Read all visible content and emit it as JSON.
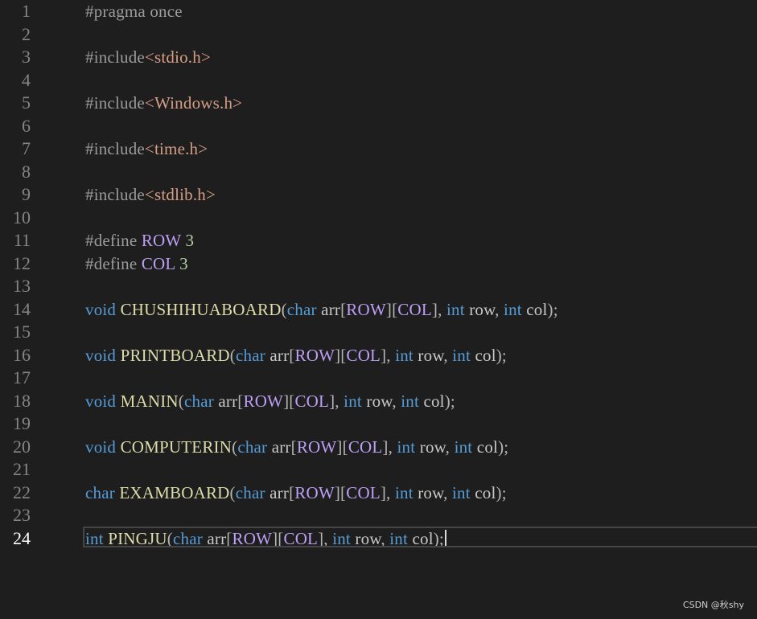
{
  "editor": {
    "lines": [
      {
        "num": "1",
        "tokens": [
          {
            "t": "pp",
            "v": "#pragma once"
          }
        ]
      },
      {
        "num": "2",
        "tokens": []
      },
      {
        "num": "3",
        "tokens": [
          {
            "t": "pp",
            "v": "#include"
          },
          {
            "t": "inc",
            "v": "<stdio.h>"
          }
        ]
      },
      {
        "num": "4",
        "tokens": []
      },
      {
        "num": "5",
        "tokens": [
          {
            "t": "pp",
            "v": "#include"
          },
          {
            "t": "inc",
            "v": "<Windows.h>"
          }
        ]
      },
      {
        "num": "6",
        "tokens": []
      },
      {
        "num": "7",
        "tokens": [
          {
            "t": "pp",
            "v": "#include"
          },
          {
            "t": "inc",
            "v": "<time.h>"
          }
        ]
      },
      {
        "num": "8",
        "tokens": []
      },
      {
        "num": "9",
        "tokens": [
          {
            "t": "pp",
            "v": "#include"
          },
          {
            "t": "inc",
            "v": "<stdlib.h>"
          }
        ]
      },
      {
        "num": "10",
        "tokens": []
      },
      {
        "num": "11",
        "tokens": [
          {
            "t": "pp",
            "v": "#define "
          },
          {
            "t": "mac",
            "v": "ROW"
          },
          {
            "t": "num",
            "v": " 3"
          }
        ]
      },
      {
        "num": "12",
        "tokens": [
          {
            "t": "pp",
            "v": "#define "
          },
          {
            "t": "mac",
            "v": "COL"
          },
          {
            "t": "num",
            "v": " 3"
          }
        ]
      },
      {
        "num": "13",
        "tokens": []
      },
      {
        "num": "14",
        "tokens": [
          {
            "t": "kw",
            "v": "void "
          },
          {
            "t": "fn",
            "v": "CHUSHIHUABOARD"
          },
          {
            "t": "pun",
            "v": "("
          },
          {
            "t": "kw",
            "v": "char "
          },
          {
            "t": "id",
            "v": "arr"
          },
          {
            "t": "pun",
            "v": "["
          },
          {
            "t": "mac",
            "v": "ROW"
          },
          {
            "t": "pun",
            "v": "]["
          },
          {
            "t": "mac",
            "v": "COL"
          },
          {
            "t": "pun",
            "v": "], "
          },
          {
            "t": "kw",
            "v": "int "
          },
          {
            "t": "id",
            "v": "row"
          },
          {
            "t": "pun",
            "v": ", "
          },
          {
            "t": "kw",
            "v": "int "
          },
          {
            "t": "id",
            "v": "col"
          },
          {
            "t": "pun",
            "v": ");"
          }
        ]
      },
      {
        "num": "15",
        "tokens": []
      },
      {
        "num": "16",
        "tokens": [
          {
            "t": "kw",
            "v": "void "
          },
          {
            "t": "fn",
            "v": "PRINTBOARD"
          },
          {
            "t": "pun",
            "v": "("
          },
          {
            "t": "kw",
            "v": "char "
          },
          {
            "t": "id",
            "v": "arr"
          },
          {
            "t": "pun",
            "v": "["
          },
          {
            "t": "mac",
            "v": "ROW"
          },
          {
            "t": "pun",
            "v": "]["
          },
          {
            "t": "mac",
            "v": "COL"
          },
          {
            "t": "pun",
            "v": "], "
          },
          {
            "t": "kw",
            "v": "int "
          },
          {
            "t": "id",
            "v": "row"
          },
          {
            "t": "pun",
            "v": ", "
          },
          {
            "t": "kw",
            "v": "int "
          },
          {
            "t": "id",
            "v": "col"
          },
          {
            "t": "pun",
            "v": ");"
          }
        ]
      },
      {
        "num": "17",
        "tokens": []
      },
      {
        "num": "18",
        "tokens": [
          {
            "t": "kw",
            "v": "void "
          },
          {
            "t": "fn",
            "v": "MANIN"
          },
          {
            "t": "pun",
            "v": "("
          },
          {
            "t": "kw",
            "v": "char "
          },
          {
            "t": "id",
            "v": "arr"
          },
          {
            "t": "pun",
            "v": "["
          },
          {
            "t": "mac",
            "v": "ROW"
          },
          {
            "t": "pun",
            "v": "]["
          },
          {
            "t": "mac",
            "v": "COL"
          },
          {
            "t": "pun",
            "v": "], "
          },
          {
            "t": "kw",
            "v": "int "
          },
          {
            "t": "id",
            "v": "row"
          },
          {
            "t": "pun",
            "v": ", "
          },
          {
            "t": "kw",
            "v": "int "
          },
          {
            "t": "id",
            "v": "col"
          },
          {
            "t": "pun",
            "v": ");"
          }
        ]
      },
      {
        "num": "19",
        "tokens": []
      },
      {
        "num": "20",
        "tokens": [
          {
            "t": "kw",
            "v": "void "
          },
          {
            "t": "fn",
            "v": "COMPUTERIN"
          },
          {
            "t": "pun",
            "v": "("
          },
          {
            "t": "kw",
            "v": "char "
          },
          {
            "t": "id",
            "v": "arr"
          },
          {
            "t": "pun",
            "v": "["
          },
          {
            "t": "mac",
            "v": "ROW"
          },
          {
            "t": "pun",
            "v": "]["
          },
          {
            "t": "mac",
            "v": "COL"
          },
          {
            "t": "pun",
            "v": "], "
          },
          {
            "t": "kw",
            "v": "int "
          },
          {
            "t": "id",
            "v": "row"
          },
          {
            "t": "pun",
            "v": ", "
          },
          {
            "t": "kw",
            "v": "int "
          },
          {
            "t": "id",
            "v": "col"
          },
          {
            "t": "pun",
            "v": ");"
          }
        ]
      },
      {
        "num": "21",
        "tokens": []
      },
      {
        "num": "22",
        "tokens": [
          {
            "t": "kw",
            "v": "char "
          },
          {
            "t": "fn",
            "v": "EXAMBOARD"
          },
          {
            "t": "pun",
            "v": "("
          },
          {
            "t": "kw",
            "v": "char "
          },
          {
            "t": "id",
            "v": "arr"
          },
          {
            "t": "pun",
            "v": "["
          },
          {
            "t": "mac",
            "v": "ROW"
          },
          {
            "t": "pun",
            "v": "]["
          },
          {
            "t": "mac",
            "v": "COL"
          },
          {
            "t": "pun",
            "v": "], "
          },
          {
            "t": "kw",
            "v": "int "
          },
          {
            "t": "id",
            "v": "row"
          },
          {
            "t": "pun",
            "v": ", "
          },
          {
            "t": "kw",
            "v": "int "
          },
          {
            "t": "id",
            "v": "col"
          },
          {
            "t": "pun",
            "v": ");"
          }
        ]
      },
      {
        "num": "23",
        "tokens": []
      },
      {
        "num": "24",
        "current": true,
        "tokens": [
          {
            "t": "kw",
            "v": "int "
          },
          {
            "t": "fn",
            "v": "PINGJU"
          },
          {
            "t": "pun",
            "v": "("
          },
          {
            "t": "kw",
            "v": "char "
          },
          {
            "t": "id",
            "v": "arr"
          },
          {
            "t": "pun",
            "v": "["
          },
          {
            "t": "mac",
            "v": "ROW"
          },
          {
            "t": "pun",
            "v": "]["
          },
          {
            "t": "mac",
            "v": "COL"
          },
          {
            "t": "pun",
            "v": "], "
          },
          {
            "t": "kw",
            "v": "int "
          },
          {
            "t": "id",
            "v": "row"
          },
          {
            "t": "pun",
            "v": ", "
          },
          {
            "t": "kw",
            "v": "int "
          },
          {
            "t": "id",
            "v": "col"
          },
          {
            "t": "pun",
            "v": ");"
          }
        ]
      }
    ]
  },
  "colors": {
    "background": "#1e1e1e",
    "keyword": "#569cd6",
    "function": "#dcdcaa",
    "macro": "#bd9ff5",
    "include_path": "#d69d85",
    "preprocessor": "#9b9b9b"
  },
  "watermark": "CSDN @秋shy"
}
